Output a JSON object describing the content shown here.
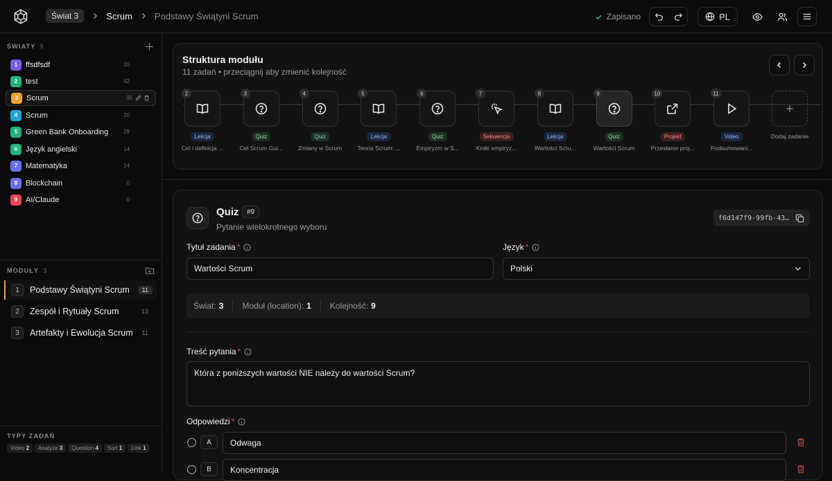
{
  "topbar": {
    "breadcrumb": [
      "Świat 3",
      "Scrum",
      "Podstawy Świątyni Scrum"
    ],
    "saved_label": "Zapisano",
    "lang_label": "PL"
  },
  "sidebar": {
    "worlds_header": "ŚWIATY",
    "worlds_count": "9",
    "worlds": [
      {
        "num": "1",
        "name": "ffsdfsdf",
        "count": "20",
        "color": "#7c5cf0"
      },
      {
        "num": "2",
        "name": "test",
        "count": "42",
        "color": "#1fb57a"
      },
      {
        "num": "3",
        "name": "Scrum",
        "count": "35",
        "color": "#f0a22e"
      },
      {
        "num": "4",
        "name": "Scrum",
        "count": "20",
        "color": "#22a6d6"
      },
      {
        "num": "5",
        "name": "Green Bank Onboarding",
        "count": "28",
        "color": "#1fb57a"
      },
      {
        "num": "6",
        "name": "Język angielski",
        "count": "14",
        "color": "#1fb57a"
      },
      {
        "num": "7",
        "name": "Matematyka",
        "count": "14",
        "color": "#6b6ef0"
      },
      {
        "num": "8",
        "name": "Blockchain",
        "count": "0",
        "color": "#6b6ef0"
      },
      {
        "num": "9",
        "name": "AI/Claude",
        "count": "0",
        "color": "#e8465a"
      }
    ],
    "modules_header": "MODUŁY",
    "modules_count": "3",
    "modules": [
      {
        "num": "1",
        "name": "Podstawy Świątyni Scrum",
        "count": "11"
      },
      {
        "num": "2",
        "name": "Zespół i Rytuały Scrum",
        "count": "13"
      },
      {
        "num": "3",
        "name": "Artefakty i Ewolucja Scrum",
        "count": "11"
      }
    ],
    "types_header": "TYPY ZADAŃ",
    "types": [
      {
        "label": "Video",
        "count": "2"
      },
      {
        "label": "Analyze",
        "count": "3"
      },
      {
        "label": "Question",
        "count": "4"
      },
      {
        "label": "Sort",
        "count": "1"
      },
      {
        "label": "Link",
        "count": "1"
      }
    ]
  },
  "structure": {
    "title": "Struktura modułu",
    "subtitle": "11 zadań • przeciągnij aby zmienić kolejność",
    "tasks": [
      {
        "num": "2",
        "type": "Lekcja",
        "icon": "book-icon",
        "label": "Cel i definicja ..."
      },
      {
        "num": "3",
        "type": "Quiz",
        "icon": "question-icon",
        "label": "Cel Scrum Gui..."
      },
      {
        "num": "4",
        "type": "Quiz",
        "icon": "question-icon",
        "label": "Zmiany w Scrum"
      },
      {
        "num": "5",
        "type": "Lekcja",
        "icon": "book-icon",
        "label": "Teoria Scrum: ..."
      },
      {
        "num": "6",
        "type": "Quiz",
        "icon": "question-icon",
        "label": "Empiryzm w S..."
      },
      {
        "num": "7",
        "type": "Sekwencja",
        "icon": "pointer-click-icon",
        "label": "Kroki empiryz..."
      },
      {
        "num": "8",
        "type": "Lekcja",
        "icon": "book-icon",
        "label": "Wartości Scru..."
      },
      {
        "num": "9",
        "type": "Quiz",
        "icon": "question-icon",
        "label": "Wartości Scrum"
      },
      {
        "num": "10",
        "type": "Projekt",
        "icon": "external-link-icon",
        "label": "Przesłanie proj..."
      },
      {
        "num": "11",
        "type": "Video",
        "icon": "play-icon",
        "label": "Podsumowani..."
      }
    ],
    "add_label": "Dodaj zadanie"
  },
  "quiz": {
    "title": "Quiz",
    "badge": "#9",
    "subtitle": "Pytanie wielokrotnego wyboru",
    "uuid": "f6d147f9-99fb-43…",
    "title_label": "Tytuł zadania",
    "title_value": "Wartości Scrum",
    "lang_label": "Język",
    "lang_value": "Polski",
    "meta": [
      {
        "label": "Świat:",
        "value": "3"
      },
      {
        "label": "Moduł (location):",
        "value": "1"
      },
      {
        "label": "Kolejność:",
        "value": "9"
      }
    ],
    "question_label": "Treść pytania",
    "question_value": "Która z poniższych wartości NIE należy do wartości Scrum?",
    "answers_label": "Odpowiedzi",
    "answers": [
      {
        "letter": "A",
        "text": "Odwaga"
      },
      {
        "letter": "B",
        "text": "Koncentracja"
      }
    ]
  }
}
